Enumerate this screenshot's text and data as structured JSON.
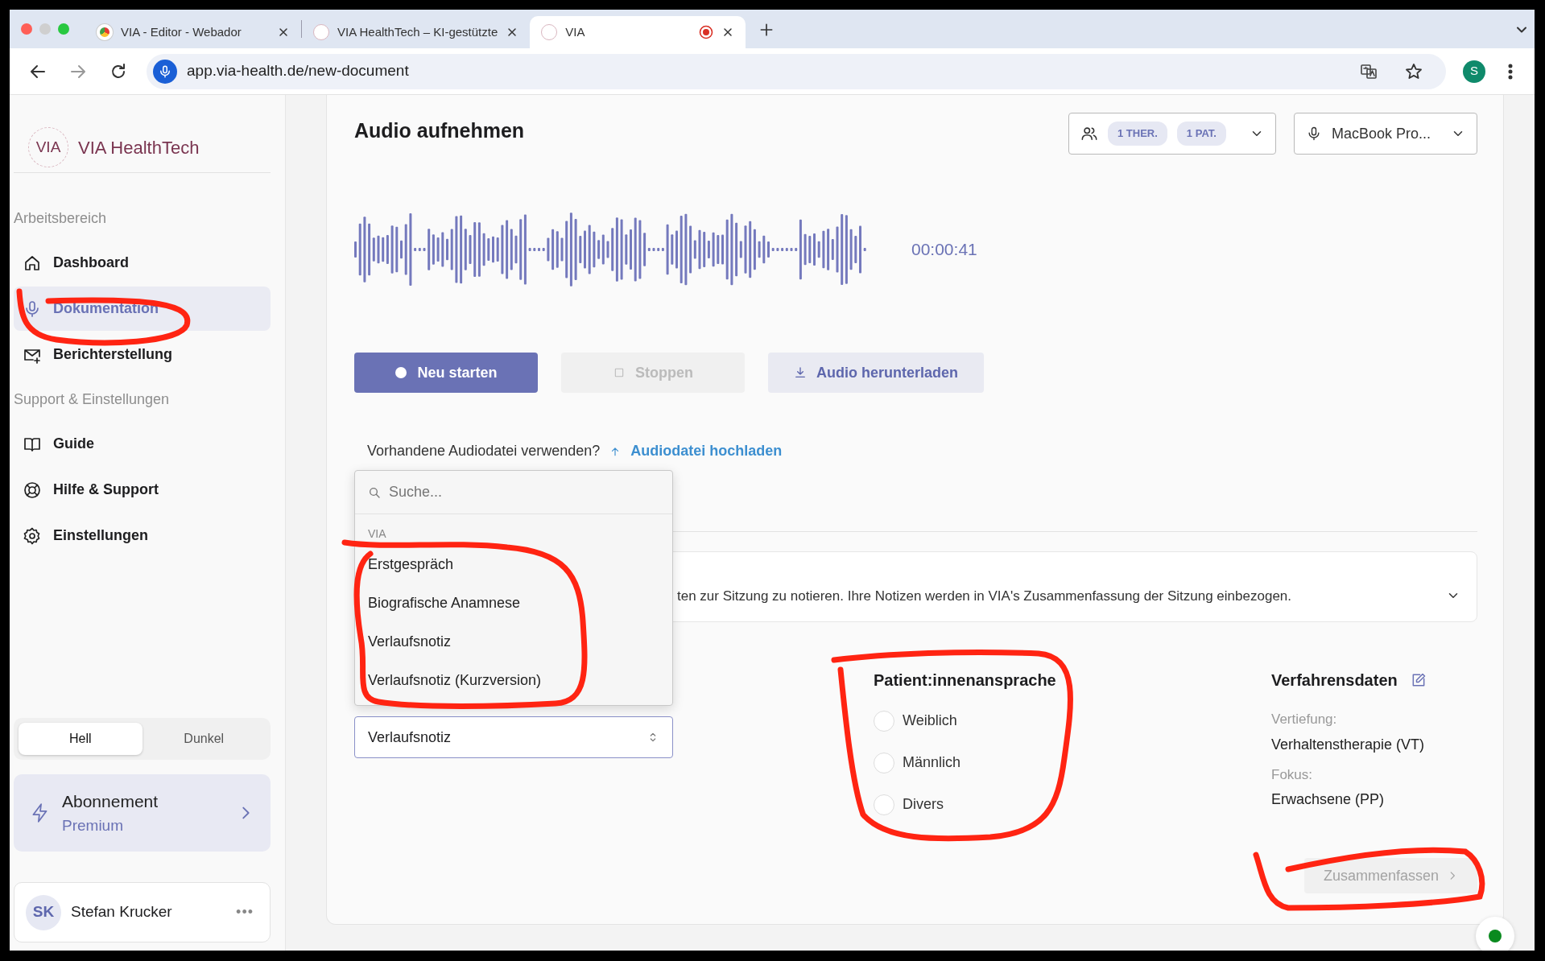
{
  "browser": {
    "tabs": [
      {
        "title": "VIA - Editor - Webador",
        "selected": false,
        "recording": false
      },
      {
        "title": "VIA HealthTech – KI-gestützte",
        "selected": false,
        "recording": false
      },
      {
        "title": "VIA",
        "selected": true,
        "recording": true
      }
    ],
    "url": "app.via-health.de/new-document",
    "profile": "S"
  },
  "sidebar": {
    "logo": "VIA",
    "brand": "VIA HealthTech",
    "sections": [
      {
        "heading": "Arbeitsbereich",
        "items": [
          {
            "label": "Dashboard",
            "kind": "home",
            "selected": false
          },
          {
            "label": "Dokumentation",
            "kind": "mic",
            "selected": true
          },
          {
            "label": "Berichterstellung",
            "kind": "mail",
            "selected": false
          }
        ]
      },
      {
        "heading": "Support & Einstellungen",
        "items": [
          {
            "label": "Guide",
            "kind": "book",
            "selected": false
          },
          {
            "label": "Hilfe & Support",
            "kind": "lifebuoy",
            "selected": false
          },
          {
            "label": "Einstellungen",
            "kind": "gear",
            "selected": false
          }
        ]
      }
    ],
    "theme": [
      {
        "label": "Hell",
        "selected": true
      },
      {
        "label": "Dunkel",
        "selected": false
      }
    ],
    "subscription": {
      "title": "Abonnement",
      "plan": "Premium"
    },
    "user": {
      "initials": "SK",
      "name": "Stefan Krucker",
      "menu": "•••"
    }
  },
  "main": {
    "title": "Audio aufnehmen",
    "participants": [
      "1 THER.",
      "1 PAT."
    ],
    "microphone": "MacBook Pro...",
    "timer": "00:00:41",
    "buttons": [
      {
        "label": "Neu starten",
        "kind": "record",
        "disabled": false
      },
      {
        "label": "Stoppen",
        "kind": "stop",
        "disabled": true
      },
      {
        "label": "Audio herunterladen",
        "kind": "download",
        "disabled": false
      }
    ],
    "upload_prompt": "Vorhandene Audiodatei verwenden?",
    "upload_link": "Audiodatei hochladen",
    "notes_text": "ten zur Sitzung zu notieren. Ihre Notizen werden in VIA's Zusammenfassung der Sitzung einbezogen.",
    "template": {
      "value": "Verlaufsnotiz",
      "expanded": true,
      "search_placeholder": "Suche...",
      "group": "VIA",
      "options": [
        "Erstgespräch",
        "Biografische Anamnese",
        "Verlaufsnotiz",
        "Verlaufsnotiz (Kurzversion)"
      ]
    },
    "address": {
      "title": "Patient:innenansprache",
      "options": [
        {
          "label": "Weiblich",
          "selected": false
        },
        {
          "label": "Männlich",
          "selected": false
        },
        {
          "label": "Divers",
          "selected": false
        }
      ]
    },
    "procedure": {
      "title": "Verfahrensdaten",
      "fields": [
        {
          "label": "Vertiefung:",
          "value": "Verhaltenstherapie (VT)"
        },
        {
          "label": "Fokus:",
          "value": "Erwachsene (PP)"
        }
      ]
    },
    "submit": {
      "label": "Zusammenfassen",
      "disabled": true
    }
  }
}
